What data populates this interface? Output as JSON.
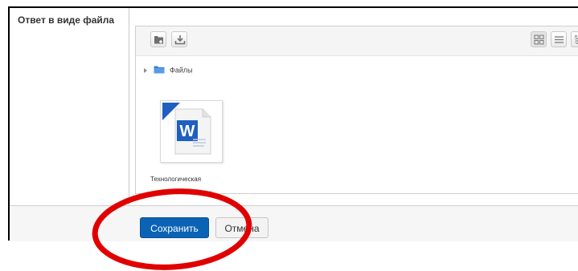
{
  "form": {
    "field_label": "Ответ в виде файла"
  },
  "filemanager": {
    "toolbar": {
      "left_buttons": [
        "add-file-icon",
        "download-icon"
      ],
      "view_buttons": [
        "view-icons-icon",
        "view-list-icon",
        "view-tree-icon"
      ]
    },
    "path": {
      "folder_label": "Файлы"
    },
    "files": [
      {
        "name": "Технологическая",
        "name_tail": ".",
        "icon": "word-document-icon"
      }
    ]
  },
  "actions": {
    "save_label": "Сохранить",
    "cancel_label": "Отмена"
  },
  "colors": {
    "primary_button": "#0a63b5",
    "annotation_red": "#e00000",
    "folder_blue": "#3b7fd1",
    "word_blue": "#1f5fbf"
  }
}
